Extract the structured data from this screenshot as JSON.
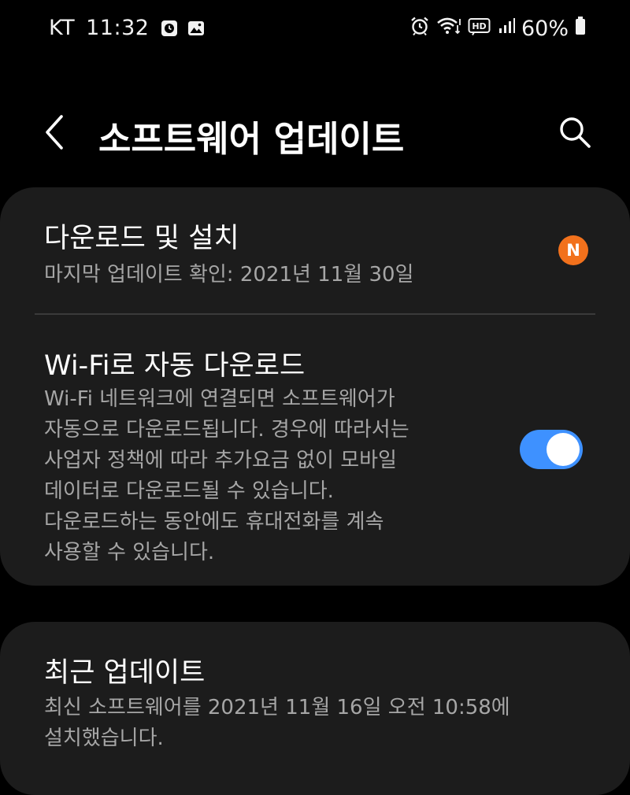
{
  "status_bar": {
    "carrier": "KT",
    "time": "11:32",
    "left_icons": [
      "notification-clock-icon",
      "gallery-icon"
    ],
    "right_icons": [
      "alarm-icon",
      "wifi-icon",
      "hd-voice-icon",
      "signal-icon",
      "battery-icon"
    ],
    "hd_label": "HD",
    "battery": "60%"
  },
  "header": {
    "title": "소프트웨어 업데이트",
    "back_icon": "chevron-left-icon",
    "search_icon": "search-icon"
  },
  "settings": {
    "download_install": {
      "title": "다운로드 및 설치",
      "subtitle": "마지막 업데이트 확인: 2021년 11월 30일",
      "badge": "N",
      "badge_color": "#f2711c"
    },
    "wifi_auto_download": {
      "title": "Wi-Fi로 자동 다운로드",
      "description_lines": [
        "Wi-Fi 네트워크에 연결되면 소프트웨어가",
        "자동으로 다운로드됩니다. 경우에 따라서는",
        "사업자 정책에 따라 추가요금 없이 모바일",
        "데이터로 다운로드될 수 있습니다.",
        "다운로드하는 동안에도 휴대전화를 계속",
        "사용할 수 있습니다."
      ],
      "toggle_on": true,
      "toggle_color": "#3e91ff"
    },
    "recent_update": {
      "title": "최근 업데이트",
      "description_lines": [
        "최신 소프트웨어를 2021년 11월 16일 오전 10:58에",
        "설치했습니다."
      ]
    }
  }
}
